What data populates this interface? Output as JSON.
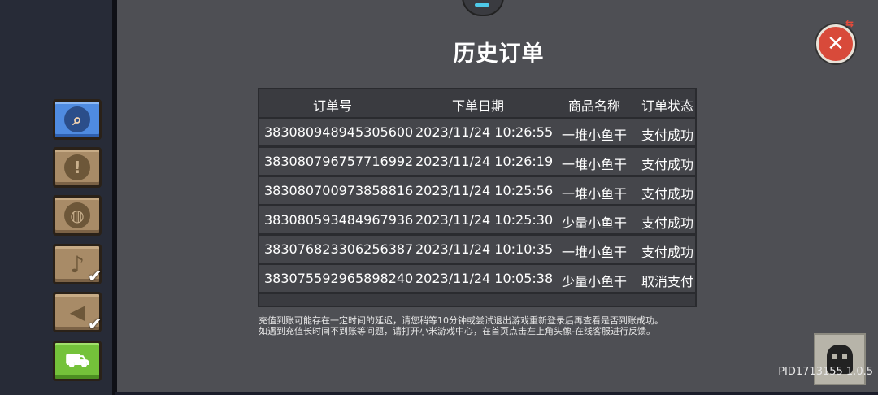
{
  "window": {
    "title": "历史订单",
    "version_label": "PID1713155 1.0.5"
  },
  "sidebar": {
    "buttons": [
      {
        "name": "account",
        "icon": "search-user-icon",
        "checked": false
      },
      {
        "name": "notice",
        "icon": "exclamation-icon",
        "checked": false
      },
      {
        "name": "language",
        "icon": "globe-icon",
        "checked": false
      },
      {
        "name": "music",
        "icon": "music-note-icon",
        "checked": true
      },
      {
        "name": "sound",
        "icon": "speaker-icon",
        "checked": true
      },
      {
        "name": "shop",
        "icon": "cart-icon",
        "checked": false
      }
    ]
  },
  "table": {
    "headers": {
      "id": "订单号",
      "date": "下单日期",
      "name": "商品名称",
      "status": "订单状态"
    },
    "rows": [
      {
        "id": "383080948945305600",
        "date": "2023/11/24 10:26:55",
        "name": "一堆小鱼干",
        "status": "支付成功"
      },
      {
        "id": "383080796757716992",
        "date": "2023/11/24 10:26:19",
        "name": "一堆小鱼干",
        "status": "支付成功"
      },
      {
        "id": "383080700973858816",
        "date": "2023/11/24 10:25:56",
        "name": "一堆小鱼干",
        "status": "支付成功"
      },
      {
        "id": "383080593484967936",
        "date": "2023/11/24 10:25:30",
        "name": "少量小鱼干",
        "status": "支付成功"
      },
      {
        "id": "383076823306256387",
        "date": "2023/11/24 10:10:35",
        "name": "一堆小鱼干",
        "status": "支付成功"
      },
      {
        "id": "383075592965898240",
        "date": "2023/11/24 10:05:38",
        "name": "少量小鱼干",
        "status": "取消支付"
      }
    ]
  },
  "notice": {
    "line1": "充值到账可能存在一定时间的延迟，请您稍等10分钟或尝试退出游戏重新登录后再查看是否到账成功。",
    "line2": "如遇到充值长时间不到账等问题，请打开小米游戏中心，在首页点击左上角头像-在线客服进行反馈。"
  },
  "colors": {
    "panel": "#4e4f54",
    "table": "#3a3b40",
    "close": "#d84a3a",
    "accent_blue": "#4f8be0",
    "accent_green": "#74c23a"
  }
}
